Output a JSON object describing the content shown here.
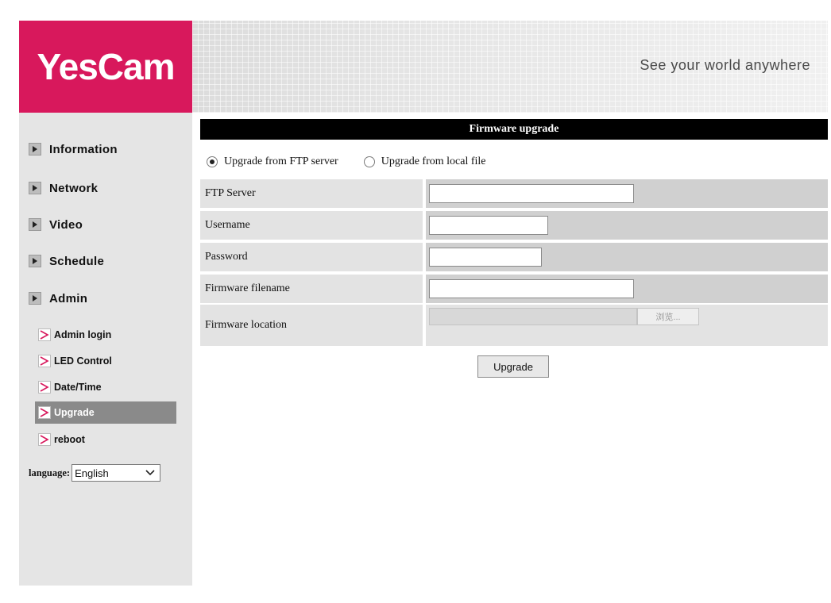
{
  "header": {
    "logo_text": "YesCam",
    "tagline": "See your world anywhere"
  },
  "sidebar": {
    "main_items": [
      {
        "label": "Information"
      },
      {
        "label": "Network"
      },
      {
        "label": "Video"
      },
      {
        "label": "Schedule"
      },
      {
        "label": "Admin"
      }
    ],
    "admin_items": [
      {
        "label": "Admin login"
      },
      {
        "label": "LED Control"
      },
      {
        "label": "Date/Time"
      },
      {
        "label": "Upgrade",
        "active": true
      },
      {
        "label": "reboot"
      }
    ],
    "language_label": "language:",
    "language_value": "English"
  },
  "main": {
    "title": "Firmware upgrade",
    "radio_options": [
      {
        "label": "Upgrade from FTP server",
        "checked": true
      },
      {
        "label": "Upgrade from local file",
        "checked": false
      }
    ],
    "fields": [
      {
        "label": "FTP Server",
        "value": ""
      },
      {
        "label": "Username",
        "value": ""
      },
      {
        "label": "Password",
        "value": ""
      },
      {
        "label": "Firmware filename",
        "value": ""
      }
    ],
    "location_label": "Firmware location",
    "browse_label": "浏览...",
    "upgrade_button": "Upgrade"
  },
  "colors": {
    "brand": "#d8185c",
    "title_bar": "#000000",
    "active_nav": "#8a8a8a",
    "sub_arrow": "#d8185c"
  },
  "icons": {
    "nav_arrow": "triangle-right-icon",
    "sub_arrow": "chevron-right-icon",
    "select_arrow": "chevron-down-icon"
  }
}
